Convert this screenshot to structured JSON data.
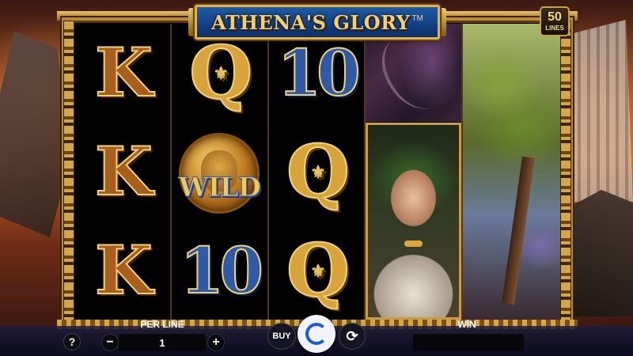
{
  "game": {
    "title": "Athena's Glory",
    "title_display": "ATHENA'S GLORY",
    "trademark": "TM",
    "lines_count": "50",
    "lines_label": "LINES"
  },
  "reels": [
    [
      "K",
      "K",
      "K"
    ],
    [
      "Q",
      "WILD",
      "10"
    ],
    [
      "10",
      "Q",
      "Q"
    ],
    [
      "big-symbol-top",
      "medusa",
      "medusa"
    ],
    [
      "tree-scene",
      "tree-scene",
      "tree-scene"
    ]
  ],
  "symbols": {
    "k": "K",
    "q": "Q",
    "ten": "10",
    "wild": "WILD"
  },
  "controls": {
    "help_label": "?",
    "per_line_label": "PER LINE",
    "per_line_value": "1",
    "minus_label": "−",
    "plus_label": "+",
    "buy_label": "BUY",
    "autoplay_icon": "⟳",
    "win_label": "WIN",
    "win_value": ""
  },
  "colors": {
    "frame_gold": "#b8893a",
    "banner_blue": "#1f5aa8",
    "title_gold": "#f4d070",
    "spin_blue": "#1e5ad6",
    "symbol_k": "#a85e1c",
    "symbol_q": "#d6a43a",
    "symbol_10": "#2e5aa8"
  }
}
